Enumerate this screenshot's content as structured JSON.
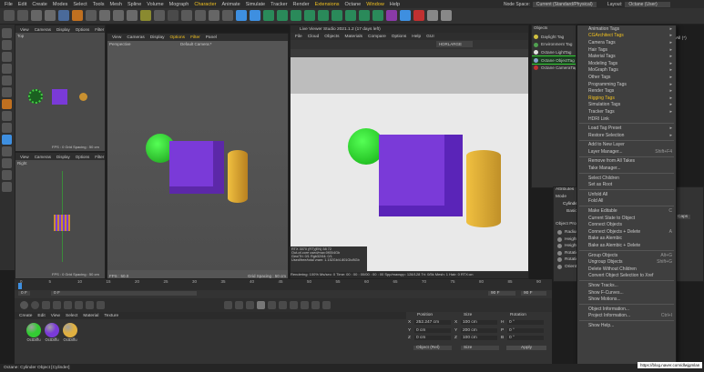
{
  "menubar": {
    "items": [
      "File",
      "Edit",
      "Create",
      "Modes",
      "Select",
      "Tools",
      "Mesh",
      "Spline",
      "Volume",
      "Mograph",
      "Character",
      "Animate",
      "Simulate",
      "Tracker",
      "Render",
      "Extensions",
      "Octane",
      "Window",
      "Help"
    ],
    "node_space_label": "Node Space:",
    "node_space_value": "Current (Standard/Physical)",
    "layout_label": "Layout:",
    "layout_value": "Octane (User)"
  },
  "viewport_top": {
    "menu": [
      "View",
      "Cameras",
      "Display",
      "Options",
      "Filter",
      "Panel"
    ],
    "name": "Top",
    "footer": "FPS : 0     Grid Spacing : 50 cm"
  },
  "viewport_right": {
    "menu": [
      "View",
      "Cameras",
      "Display",
      "Options",
      "Filter",
      "Panel"
    ],
    "name": "Right",
    "footer": "FPS : 0     Grid Spacing : 50 cm"
  },
  "viewport_persp": {
    "menu": [
      "View",
      "Cameras",
      "Display",
      "Options",
      "Filter",
      "Panel"
    ],
    "name": "Perspective",
    "camera": "Default Camera:*",
    "footer_fps": "FPS : 50.0",
    "footer_grid": "Grid Spacing : 50 cm"
  },
  "live_viewer": {
    "title": "Live Viewer Studio 2021.1.2 (17 days left)",
    "menu": [
      "File",
      "Cloud",
      "Objects",
      "Materials",
      "Compare",
      "Options",
      "Help",
      "GUI"
    ],
    "preset": "HDRLARGE",
    "status": "Rendering: 100%   Ms/sec: 0   Time: 00 : 00 : 00/00 : 00 : 00   Spp/maxspp: 128/128   Tri: 0/5k   Mesh: 1   Hair: 0   RTX:on",
    "gpu_info": [
      "RTX 3070 (RT)(EN)   58   72",
      "Out-of-core used/max:0KB/4Gb",
      "Geo/Tri: 0/1   Rgb32/64: 0/1",
      "Used/free/total vram: 1.152Gb/4.801Gb/8Gb"
    ],
    "side_buttons": [
      "P",
      "L",
      "M",
      "S",
      "C",
      "I",
      "B"
    ]
  },
  "objects_panel": {
    "title": "Objects",
    "subitems": [
      "Daylight Tag",
      "Environment Tag",
      "Octane LightTag",
      "Octane ObjectTag",
      "Octane CameraTag"
    ],
    "dot_colors": [
      "#d0c040",
      "#50a050",
      "#e0e0e0",
      "#8aa0d0",
      "#c03030"
    ]
  },
  "dropdown": {
    "items": [
      {
        "label": "Animation Tags",
        "arrow": true,
        "yellow": false
      },
      {
        "label": "CGArchitect Tags",
        "arrow": true,
        "yellow": true
      },
      {
        "label": "Camera Tags",
        "arrow": true,
        "yellow": false
      },
      {
        "label": "Hair Tags",
        "arrow": true,
        "yellow": false
      },
      {
        "label": "Material Tags",
        "arrow": true,
        "yellow": false
      },
      {
        "label": "Modeling Tags",
        "arrow": true,
        "yellow": false
      },
      {
        "label": "MoGraph Tags",
        "arrow": true,
        "yellow": false
      },
      {
        "label": "Other Tags",
        "arrow": true,
        "yellow": false
      },
      {
        "label": "Programming Tags",
        "arrow": true,
        "yellow": false
      },
      {
        "label": "Render Tags",
        "arrow": true,
        "yellow": false
      },
      {
        "label": "Rigging Tags",
        "arrow": true,
        "yellow": true
      },
      {
        "label": "Simulation Tags",
        "arrow": true,
        "yellow": false
      },
      {
        "label": "Tracker Tags",
        "arrow": true,
        "yellow": false
      },
      {
        "label": "HDRI Link",
        "arrow": false,
        "yellow": false
      },
      {
        "sep": true
      },
      {
        "label": "Load Tag Preset",
        "arrow": true,
        "yellow": false
      },
      {
        "label": "Restore Selection",
        "arrow": true,
        "yellow": false
      },
      {
        "sep": true
      },
      {
        "label": "Add to New Layer",
        "arrow": false
      },
      {
        "label": "Layer Manager...",
        "shortcut": "Shift+F4"
      },
      {
        "sep": true
      },
      {
        "label": "Remove from All Takes"
      },
      {
        "label": "Take Manager..."
      },
      {
        "sep": true
      },
      {
        "label": "Select Children"
      },
      {
        "label": "Set as Root"
      },
      {
        "sep": true
      },
      {
        "label": "Unfold All"
      },
      {
        "label": "Fold All"
      },
      {
        "sep": true
      },
      {
        "label": "Make Editable",
        "shortcut": "C"
      },
      {
        "label": "Current State to Object"
      },
      {
        "label": "Connect Objects"
      },
      {
        "label": "Connect Objects + Delete",
        "shortcut": "A"
      },
      {
        "label": "Bake as Alembic"
      },
      {
        "label": "Bake as Alembic + Delete"
      },
      {
        "sep": true
      },
      {
        "label": "Group Objects",
        "shortcut": "Alt+G"
      },
      {
        "label": "Ungroup Objects",
        "shortcut": "Shift+G"
      },
      {
        "label": "Delete Without Children"
      },
      {
        "label": "Convert Object Selection to Xref"
      },
      {
        "sep": true
      },
      {
        "label": "Show Tracks..."
      },
      {
        "label": "Show F-Curves..."
      },
      {
        "label": "Show Motions..."
      },
      {
        "sep": true
      },
      {
        "label": "Object Information..."
      },
      {
        "label": "Project Information...",
        "shortcut": "Ctrl+I"
      },
      {
        "sep": true
      },
      {
        "label": "Show Help..."
      }
    ],
    "all_label": "All (*)"
  },
  "attributes": {
    "title": "Attributes",
    "mode": "Mode",
    "cylinder": "Cylinder",
    "basic": "Basic",
    "obj_props": "Object Properties",
    "rows": [
      "Radius",
      "Height",
      "Height Segm",
      "Rotation Segm",
      "Rotation",
      "Orientation"
    ],
    "caps": "Caps"
  },
  "timeline": {
    "ticks": [
      "0",
      "5",
      "10",
      "15",
      "20",
      "25",
      "30",
      "35",
      "40",
      "45",
      "50",
      "55",
      "60",
      "65",
      "70",
      "75",
      "80",
      "85",
      "90"
    ],
    "start": "0 F",
    "current": "0 F",
    "end": "90 F",
    "end2": "90 F"
  },
  "materials": {
    "menu": [
      "Create",
      "Edit",
      "View",
      "Select",
      "Material",
      "Texture"
    ],
    "items": [
      {
        "name": "OctDiffu",
        "color": "#33cc33"
      },
      {
        "name": "OctDiffu",
        "color": "#7a3ad8"
      },
      {
        "name": "OctDiffu",
        "color": "#e0b040"
      }
    ]
  },
  "coords": {
    "headers": [
      "Position",
      "Size",
      "Rotation"
    ],
    "rows": [
      [
        "X",
        "252.247 cm",
        "X",
        "100 cm",
        "H",
        "0 °"
      ],
      [
        "Y",
        "0 cm",
        "Y",
        "200 cm",
        "P",
        "0 °"
      ],
      [
        "Z",
        "0 cm",
        "Z",
        "100 cm",
        "B",
        "0 °"
      ]
    ],
    "obj_mode": "Object (Rel)",
    "size_mode": "Size",
    "apply": "Apply"
  },
  "statusbar": {
    "text": "Octane:       Cylinder Object [Cylinder]",
    "url": "https://blog.naver.com/dlwjgmlan"
  },
  "colors": {
    "purple": "#7a3ad8",
    "green": "#33cc33",
    "gold": "#e0b040",
    "accent": "#f0c020",
    "highlight": "#3e8fe0"
  }
}
